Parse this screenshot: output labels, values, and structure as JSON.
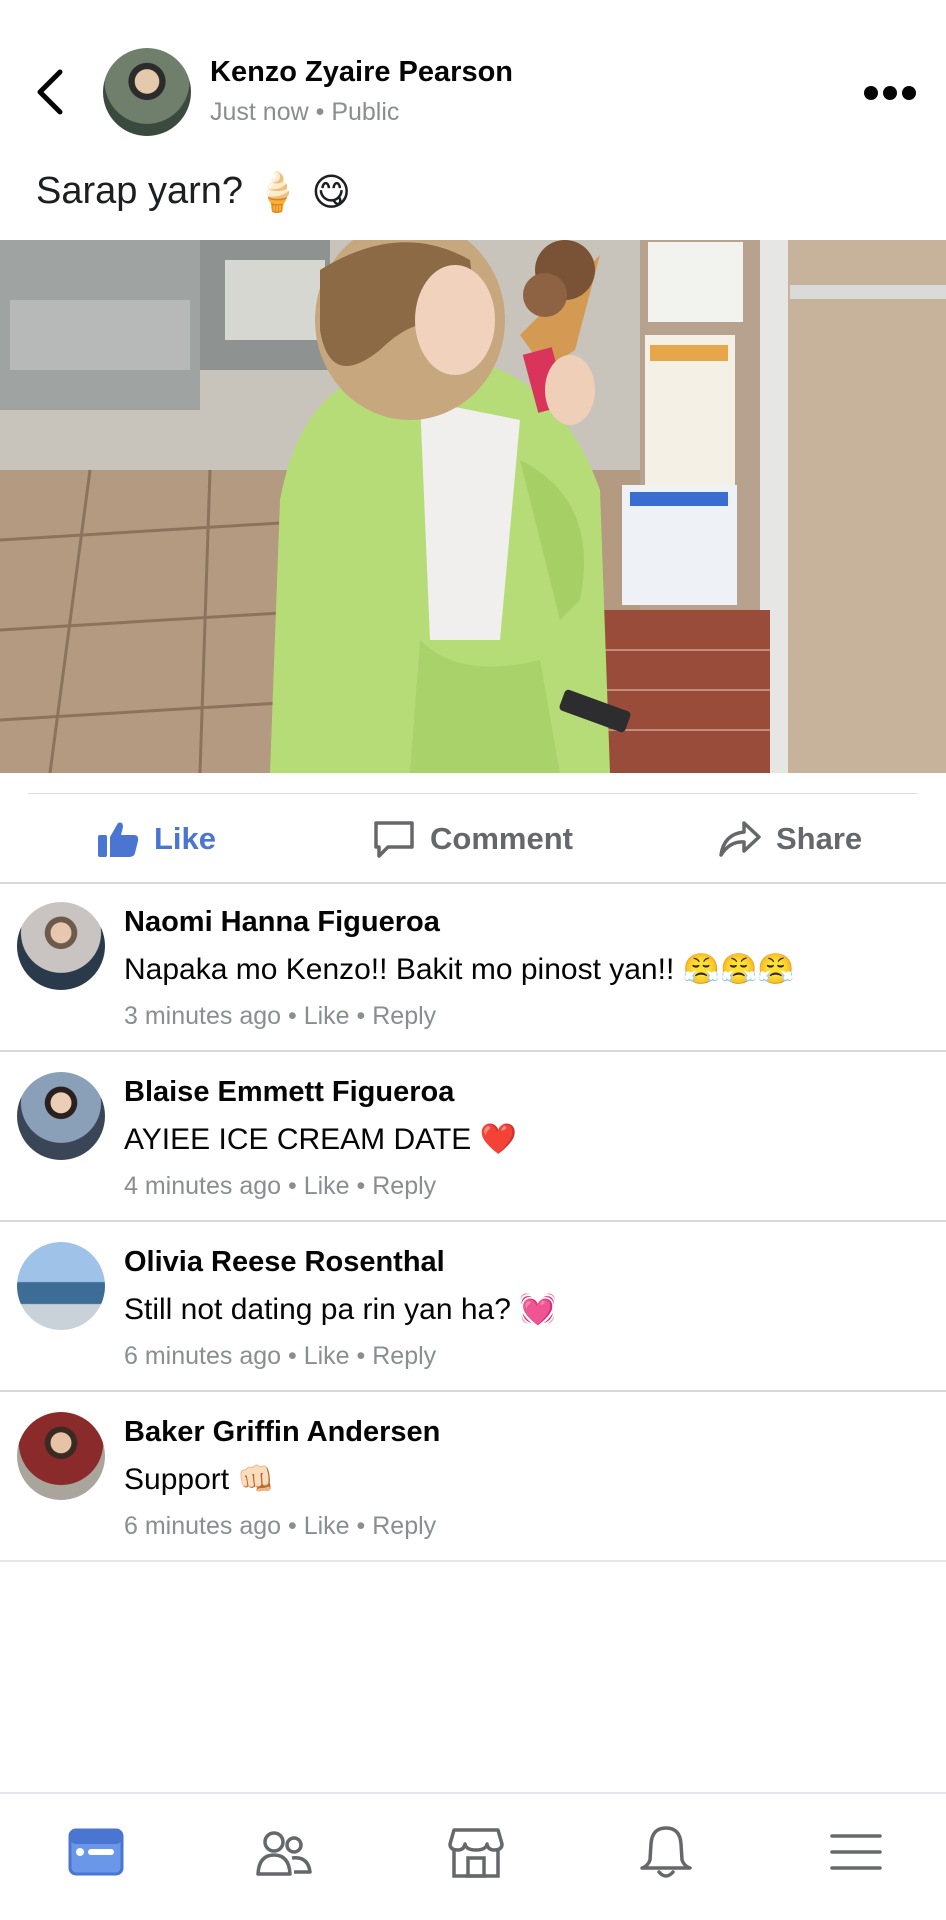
{
  "post": {
    "author": "Kenzo Zyaire Pearson",
    "time": "Just now",
    "privacy": "Public",
    "caption": "Sarap yarn?",
    "caption_emojis": [
      "🍦",
      "😋"
    ]
  },
  "actions": {
    "like": "Like",
    "comment": "Comment",
    "share": "Share"
  },
  "comments": [
    {
      "name": "Naomi Hanna Figueroa",
      "text": "Napaka mo Kenzo!! Bakit mo pinost yan!! 😤😤😤",
      "time": "3 minutes ago",
      "like": "Like",
      "reply": "Reply"
    },
    {
      "name": "Blaise Emmett Figueroa",
      "text": "AYIEE ICE CREAM DATE ❤️",
      "time": "4 minutes ago",
      "like": "Like",
      "reply": "Reply"
    },
    {
      "name": "Olivia Reese Rosenthal",
      "text": "Still not dating pa rin yan ha? 💓",
      "time": "6 minutes ago",
      "like": "Like",
      "reply": "Reply"
    },
    {
      "name": "Baker Griffin Andersen",
      "text": "Support 👊🏻",
      "time": "6 minutes ago",
      "like": "Like",
      "reply": "Reply"
    }
  ],
  "nav": [
    "news-feed-icon",
    "friends-icon",
    "marketplace-icon",
    "notifications-icon",
    "menu-icon"
  ],
  "colors": {
    "accent": "#4a76d1",
    "muted": "#8a8d91",
    "divider": "#d5d7da"
  }
}
